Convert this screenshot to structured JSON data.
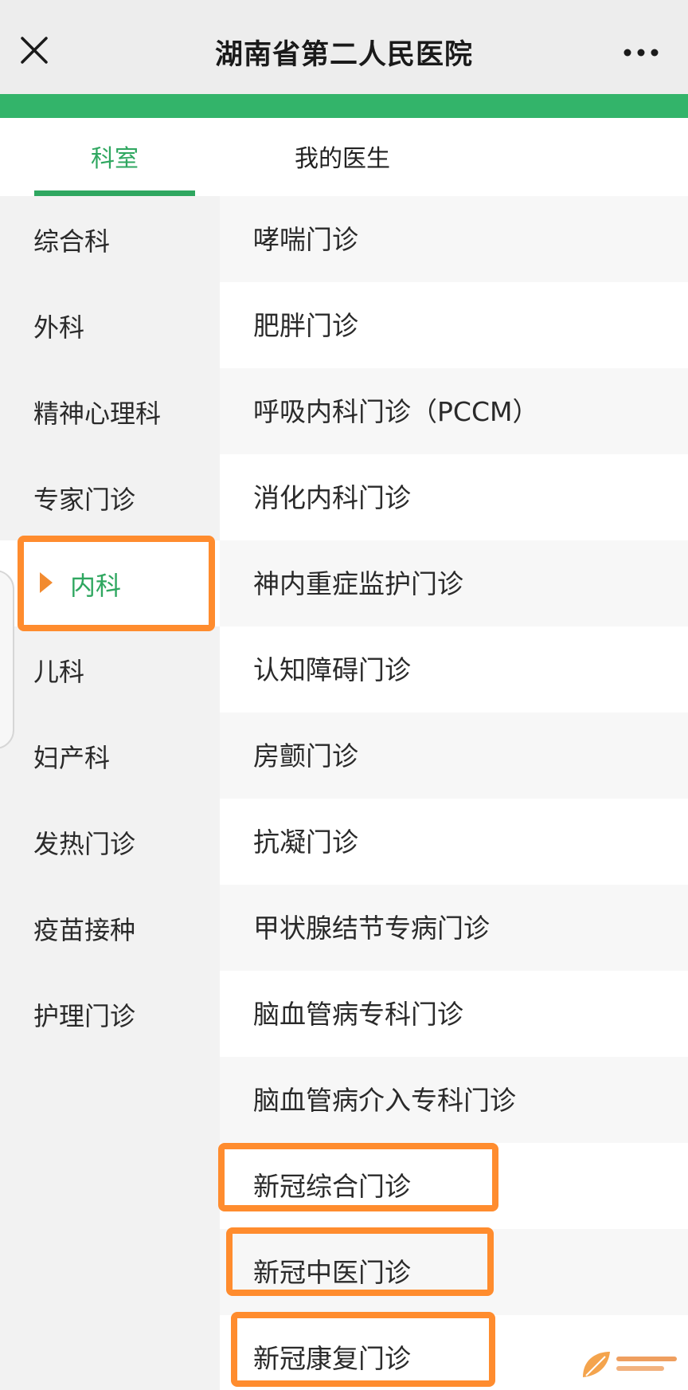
{
  "window": {
    "title": "湖南省第二人民医院"
  },
  "tabs": [
    {
      "label": "科室",
      "active": true
    },
    {
      "label": "我的医生",
      "active": false
    }
  ],
  "sidebar": {
    "items": [
      {
        "label": "综合科"
      },
      {
        "label": "外科"
      },
      {
        "label": "精神心理科"
      },
      {
        "label": "专家门诊"
      },
      {
        "label": "内科",
        "active": true
      },
      {
        "label": "儿科"
      },
      {
        "label": "妇产科"
      },
      {
        "label": "发热门诊"
      },
      {
        "label": "疫苗接种"
      },
      {
        "label": "护理门诊"
      }
    ]
  },
  "departments": [
    {
      "label": "哮喘门诊"
    },
    {
      "label": "肥胖门诊"
    },
    {
      "label": "呼吸内科门诊（PCCM）"
    },
    {
      "label": "消化内科门诊"
    },
    {
      "label": "神内重症监护门诊"
    },
    {
      "label": "认知障碍门诊"
    },
    {
      "label": "房颤门诊"
    },
    {
      "label": "抗凝门诊"
    },
    {
      "label": "甲状腺结节专病门诊"
    },
    {
      "label": "脑血管病专科门诊"
    },
    {
      "label": "脑血管病介入专科门诊"
    },
    {
      "label": "新冠综合门诊",
      "highlighted": true
    },
    {
      "label": "新冠中医门诊",
      "highlighted": true
    },
    {
      "label": "新冠康复门诊",
      "highlighted": true
    }
  ],
  "colors": {
    "accent": "#2fa760",
    "green_bar": "#33b46a",
    "highlight": "#ff8c2e",
    "active_arrow": "#f28b30"
  },
  "watermark": {
    "icon": "leaf-logo-icon"
  }
}
